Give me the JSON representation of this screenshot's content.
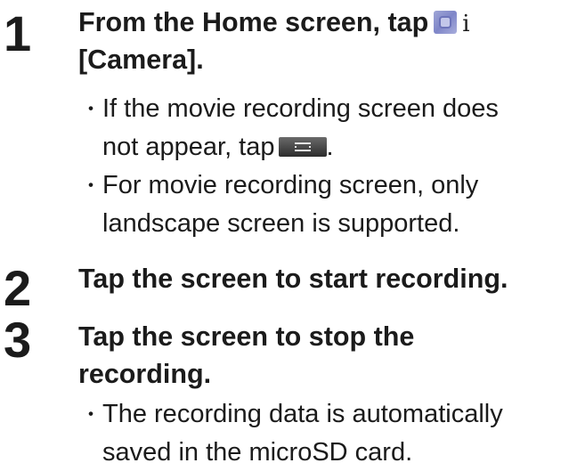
{
  "steps": [
    {
      "number": "1",
      "heading_part1": "From the Home screen, tap",
      "heading_sep": "i",
      "heading_part2": "[Camera].",
      "icon": "camera-app-icon",
      "bullets": [
        {
          "line1": "If the movie recording screen does",
          "line2_prefix": "not appear, tap",
          "line2_suffix": ".",
          "icon": "movie-mode-icon"
        },
        {
          "line1": "For movie recording screen, only",
          "line2": "landscape screen is supported."
        }
      ]
    },
    {
      "number": "2",
      "heading": "Tap the screen to start recording."
    },
    {
      "number": "3",
      "heading_line1": "Tap the screen to stop the",
      "heading_line2": "recording.",
      "bullets": [
        {
          "line1": "The recording data is automatically",
          "line2": "saved in the microSD card."
        }
      ]
    }
  ],
  "bullet_glyph": "・"
}
